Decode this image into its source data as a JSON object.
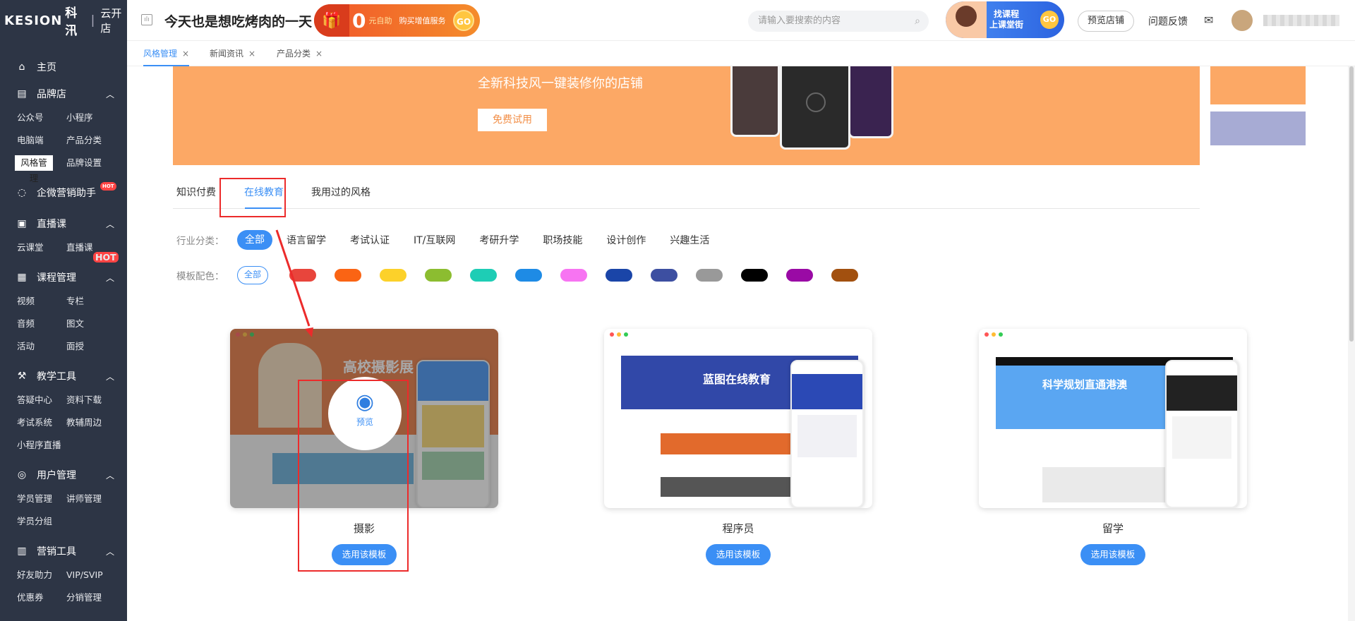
{
  "brand": {
    "name": "KESION",
    "cn": "科汛",
    "store": "云开店"
  },
  "header": {
    "slogan": "今天也是想吃烤肉的一天",
    "promo": {
      "zero": "0",
      "text1": "元自助",
      "text2": "购买增值服务",
      "go": "GO"
    },
    "search_placeholder": "请输入要搜索的内容",
    "ad": {
      "line1": "找课程",
      "line2": "上课堂街",
      "go": "GO"
    },
    "preview_store": "预览店铺",
    "feedback": "问题反馈"
  },
  "sidebar": {
    "home": "主页",
    "brand_store": {
      "label": "品牌店",
      "items": [
        "公众号",
        "小程序",
        "电脑端",
        "产品分类",
        "风格管理",
        "品牌设置"
      ]
    },
    "wecom": {
      "label": "企微营销助手",
      "hot": "HOT"
    },
    "live": {
      "label": "直播课",
      "items": [
        "云课堂",
        "直播课"
      ],
      "hot": "HOT"
    },
    "course": {
      "label": "课程管理",
      "items": [
        "视频",
        "专栏",
        "音频",
        "图文",
        "活动",
        "面授"
      ]
    },
    "tools": {
      "label": "教学工具",
      "items": [
        "答疑中心",
        "资料下载",
        "考试系统",
        "教辅周边",
        "小程序直播"
      ]
    },
    "users": {
      "label": "用户管理",
      "items": [
        "学员管理",
        "讲师管理",
        "学员分组"
      ]
    },
    "marketing": {
      "label": "营销工具",
      "items": [
        "好友助力",
        "VIP/SVIP",
        "优惠券",
        "分销管理"
      ]
    }
  },
  "page_tabs": [
    {
      "label": "风格管理",
      "close": "×"
    },
    {
      "label": "新闻资讯",
      "close": "×"
    },
    {
      "label": "产品分类",
      "close": "×"
    }
  ],
  "banner": {
    "text": "全新科技风一键装修你的店铺",
    "button": "免费试用"
  },
  "style_tabs": [
    "知识付费",
    "在线教育",
    "我用过的风格"
  ],
  "industry": {
    "label": "行业分类：",
    "options": [
      "全部",
      "语言留学",
      "考试认证",
      "IT/互联网",
      "考研升学",
      "职场技能",
      "设计创作",
      "兴趣生活"
    ]
  },
  "palette": {
    "label": "模板配色：",
    "all": "全部",
    "colors": [
      "#e8453c",
      "#fa6414",
      "#fcd12a",
      "#8cbd30",
      "#1ecdb5",
      "#1e8be5",
      "#f774f2",
      "#1a45a8",
      "#3d4fa1",
      "#999999",
      "#000000",
      "#9a0aa5",
      "#a2500f"
    ]
  },
  "templates": [
    {
      "name": "摄影",
      "button": "选用该模板",
      "preview": "预览",
      "title_art": "高校摄影展"
    },
    {
      "name": "程序员",
      "button": "选用该模板",
      "title_art": "蓝图在线教育"
    },
    {
      "name": "留学",
      "button": "选用该模板",
      "title_art": "科学规划直通港澳"
    }
  ]
}
